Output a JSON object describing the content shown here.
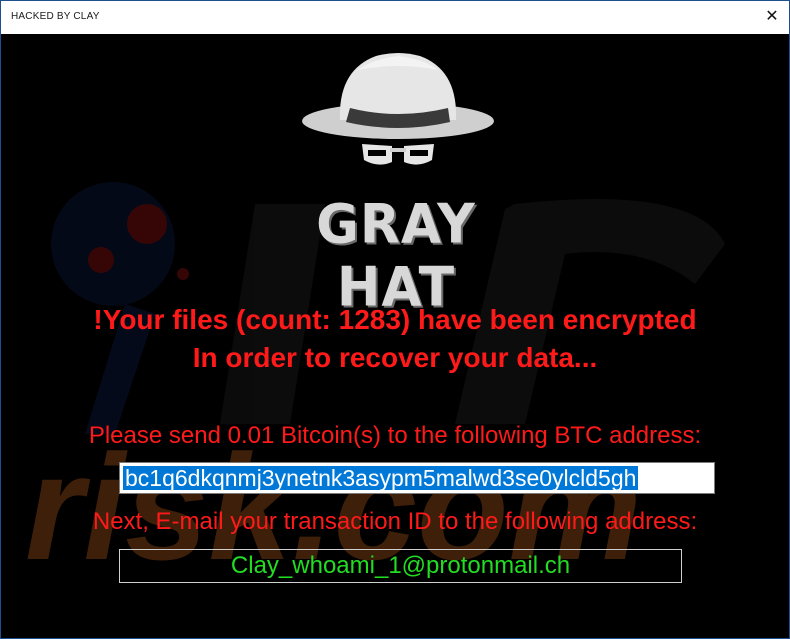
{
  "window": {
    "title": "HACKED BY CLAY",
    "close_label": "✕"
  },
  "logo_text": "GRAY HAT",
  "watermark_text": "risk.com",
  "message": {
    "line1": "!Your files (count: 1283) have been encrypted",
    "line2": "In order to recover your data...",
    "payment_instruction": "Please send 0.01 Bitcoin(s) to the following BTC address:",
    "btc_address": "bc1q6dkqnmj3ynetnk3asypm5malwd3se0ylcld5gh",
    "email_instruction": "Next, E-mail your transaction ID to the following address:",
    "email_address": "Clay_whoami_1@protonmail.ch"
  },
  "colors": {
    "text_red": "#ff1a1a",
    "email_green": "#22dd22",
    "selection_blue": "#0078d7",
    "background": "#000000"
  },
  "icons": {
    "hat": "gray-hat-icon",
    "close": "close-icon"
  }
}
